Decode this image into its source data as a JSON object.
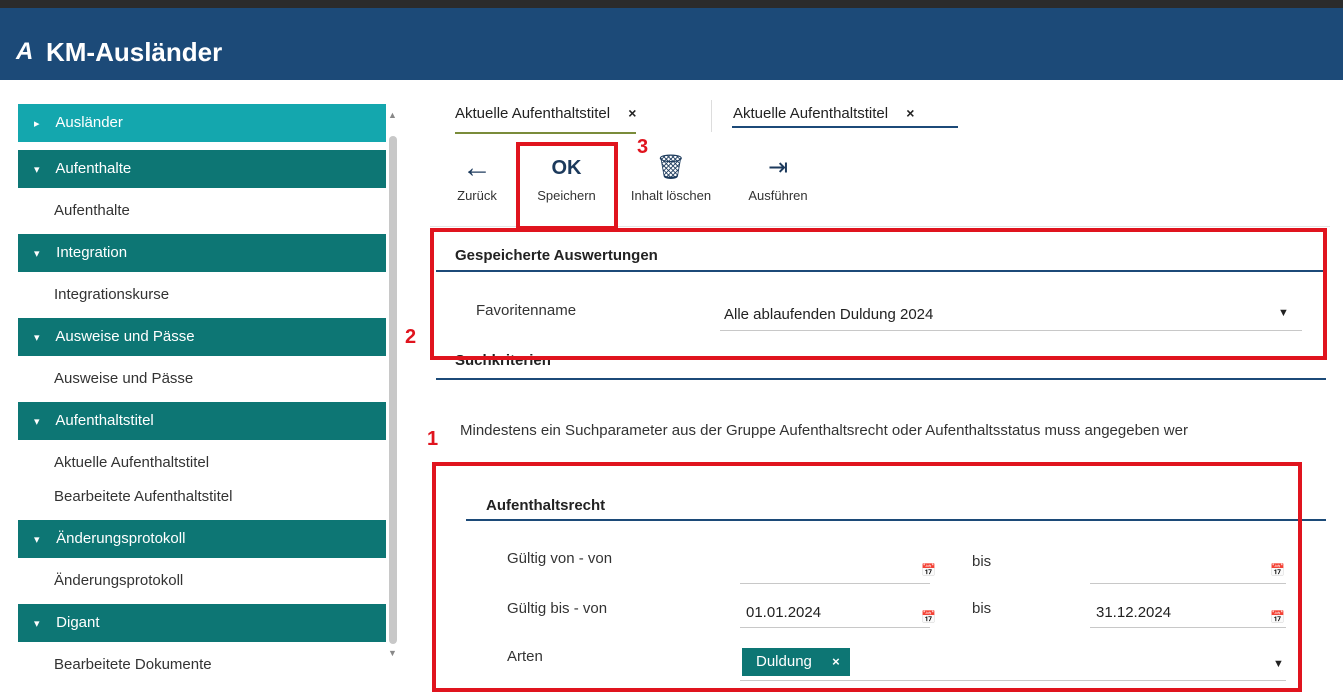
{
  "app": {
    "title": "KM-Ausländer",
    "logo_glyph": "A"
  },
  "sidebar": {
    "items": [
      {
        "type": "group",
        "label": "Ausländer",
        "caret": "▸",
        "active": true
      },
      {
        "type": "group",
        "label": "Aufenthalte",
        "caret": "▾"
      },
      {
        "type": "child",
        "label": "Aufenthalte"
      },
      {
        "type": "group",
        "label": "Integration",
        "caret": "▾"
      },
      {
        "type": "child",
        "label": "Integrationskurse"
      },
      {
        "type": "group",
        "label": "Ausweise und Pässe",
        "caret": "▾"
      },
      {
        "type": "child",
        "label": "Ausweise und Pässe"
      },
      {
        "type": "group",
        "label": "Aufenthaltstitel",
        "caret": "▾"
      },
      {
        "type": "child",
        "label": "Aktuelle Aufenthaltstitel"
      },
      {
        "type": "child",
        "label": "Bearbeitete Aufenthaltstitel"
      },
      {
        "type": "group",
        "label": "Änderungsprotokoll",
        "caret": "▾"
      },
      {
        "type": "child",
        "label": "Änderungsprotokoll"
      },
      {
        "type": "group",
        "label": "Digant",
        "caret": "▾"
      },
      {
        "type": "child",
        "label": "Bearbeitete Dokumente"
      }
    ]
  },
  "tabs": [
    {
      "label": "Aktuelle Aufenthaltstitel",
      "close": "×"
    },
    {
      "label": "Aktuelle Aufenthaltstitel",
      "close": "×"
    }
  ],
  "toolbar": {
    "back": {
      "icon": "←",
      "label": "Zurück"
    },
    "save": {
      "icon": "OK",
      "label": "Speichern"
    },
    "clear": {
      "icon": "🗑",
      "label": "Inhalt löschen"
    },
    "run": {
      "icon": "⇥",
      "label": "Ausführen"
    }
  },
  "saved_reports": {
    "title": "Gespeicherte Auswertungen",
    "favorite_label": "Favoritenname",
    "favorite_value": "Alle ablaufenden Duldung 2024"
  },
  "criteria": {
    "title": "Suchkriterien",
    "hint": "Mindestens ein Suchparameter aus der Gruppe Aufenthaltsrecht oder Aufenthaltsstatus muss angegeben wer"
  },
  "residence_right": {
    "title": "Aufenthaltsrecht",
    "valid_from_label": "Gültig von - von",
    "valid_from_from": "",
    "valid_from_to_label": "bis",
    "valid_from_to": "",
    "valid_until_label": "Gültig bis - von",
    "valid_until_from": "01.01.2024",
    "valid_until_to_label": "bis",
    "valid_until_to": "31.12.2024",
    "types_label": "Arten",
    "types_chip": "Duldung",
    "chip_close": "×"
  },
  "annotations": {
    "m1": "1",
    "m2": "2",
    "m3": "3"
  },
  "colors": {
    "header": "#1c4a78",
    "group": "#0d7674",
    "active_group": "#14a7ae",
    "highlight": "#e0141e"
  }
}
